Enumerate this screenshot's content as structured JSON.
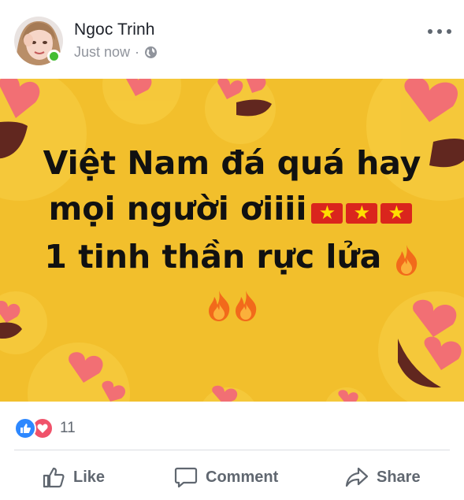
{
  "post": {
    "author": "Ngoc Trinh",
    "timestamp": "Just now",
    "separator": "·",
    "privacy_icon": "globe-icon",
    "online": true,
    "more_icon": "more-horizontal-icon",
    "image_text": {
      "line1": "Việt Nam đá quá hay",
      "line2": "mọi người ơiiii",
      "line3": "1 tinh thần rực lửa",
      "line2_emoji": [
        "vietnam-flag",
        "vietnam-flag",
        "vietnam-flag"
      ],
      "line3_emoji": [
        "fire"
      ],
      "line4_emoji": [
        "fire",
        "fire"
      ]
    },
    "image_background": "#f2bf2c"
  },
  "reactions": {
    "types": [
      "like-icon",
      "love-icon"
    ],
    "count": "11"
  },
  "actions": {
    "like_label": "Like",
    "comment_label": "Comment",
    "share_label": "Share"
  },
  "colors": {
    "like_blue": "#2d88ff",
    "love_red": "#f0526a",
    "online_green": "#44bd32",
    "action_gray": "#606770"
  }
}
